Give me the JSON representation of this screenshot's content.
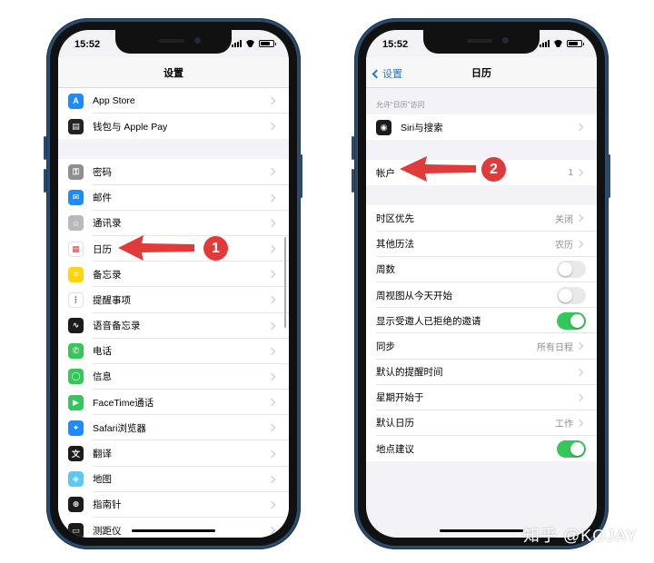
{
  "left_phone": {
    "status_time": "15:52",
    "nav_title": "设置",
    "groups": [
      [
        {
          "label": "App Store",
          "icon": "app-store-icon",
          "color": "#1a8cff",
          "glyph": "A"
        },
        {
          "label": "钱包与 Apple Pay",
          "icon": "wallet-icon",
          "color": "#222222",
          "glyph": "▤"
        }
      ],
      [
        {
          "label": "密码",
          "icon": "key-icon",
          "color": "#8e8e93",
          "glyph": "⚿"
        },
        {
          "label": "邮件",
          "icon": "mail-icon",
          "color": "#1a8cff",
          "glyph": "✉"
        },
        {
          "label": "通讯录",
          "icon": "contacts-icon",
          "color": "#b8b8bd",
          "glyph": "☺"
        },
        {
          "label": "日历",
          "icon": "calendar-icon",
          "color": "#ffffff",
          "glyph": "▦"
        },
        {
          "label": "备忘录",
          "icon": "notes-icon",
          "color": "#ffd60a",
          "glyph": "≡"
        },
        {
          "label": "提醒事项",
          "icon": "reminders-icon",
          "color": "#ffffff",
          "glyph": "⋮"
        },
        {
          "label": "语音备忘录",
          "icon": "voice-memos-icon",
          "color": "#1c1c1e",
          "glyph": "∿"
        },
        {
          "label": "电话",
          "icon": "phone-icon",
          "color": "#34c759",
          "glyph": "✆"
        },
        {
          "label": "信息",
          "icon": "messages-icon",
          "color": "#34c759",
          "glyph": "◯"
        },
        {
          "label": "FaceTime通话",
          "icon": "facetime-icon",
          "color": "#34c759",
          "glyph": "▶"
        },
        {
          "label": "Safari浏览器",
          "icon": "safari-icon",
          "color": "#1a8cff",
          "glyph": "✦"
        },
        {
          "label": "翻译",
          "icon": "translate-icon",
          "color": "#1c1c1e",
          "glyph": "文"
        },
        {
          "label": "地图",
          "icon": "maps-icon",
          "color": "#5ac8fa",
          "glyph": "◈"
        },
        {
          "label": "指南针",
          "icon": "compass-icon",
          "color": "#1c1c1e",
          "glyph": "⊕"
        },
        {
          "label": "测距仪",
          "icon": "measure-icon",
          "color": "#1c1c1e",
          "glyph": "▭"
        }
      ]
    ]
  },
  "right_phone": {
    "status_time": "15:52",
    "nav_title": "日历",
    "back_label": "设置",
    "section_label": "允许“日历”访问",
    "siri_label": "Siri与搜索",
    "account_label": "帐户",
    "account_value": "1",
    "rows": [
      {
        "label": "时区优先",
        "type": "value",
        "value": "关闭"
      },
      {
        "label": "其他历法",
        "type": "value",
        "value": "农历"
      },
      {
        "label": "周数",
        "type": "toggle",
        "on": false
      },
      {
        "label": "周视图从今天开始",
        "type": "toggle",
        "on": false
      },
      {
        "label": "显示受邀人已拒绝的邀请",
        "type": "toggle",
        "on": true
      },
      {
        "label": "同步",
        "type": "value",
        "value": "所有日程"
      },
      {
        "label": "默认的提醒时间",
        "type": "value",
        "value": ""
      },
      {
        "label": "星期开始于",
        "type": "value",
        "value": ""
      },
      {
        "label": "默认日历",
        "type": "value",
        "value": "工作"
      },
      {
        "label": "地点建议",
        "type": "toggle",
        "on": true
      }
    ]
  },
  "annotations": {
    "badge_1": "1",
    "badge_2": "2",
    "arrow_color": "#e03a3a"
  },
  "watermark": "知乎 @KOJAY"
}
